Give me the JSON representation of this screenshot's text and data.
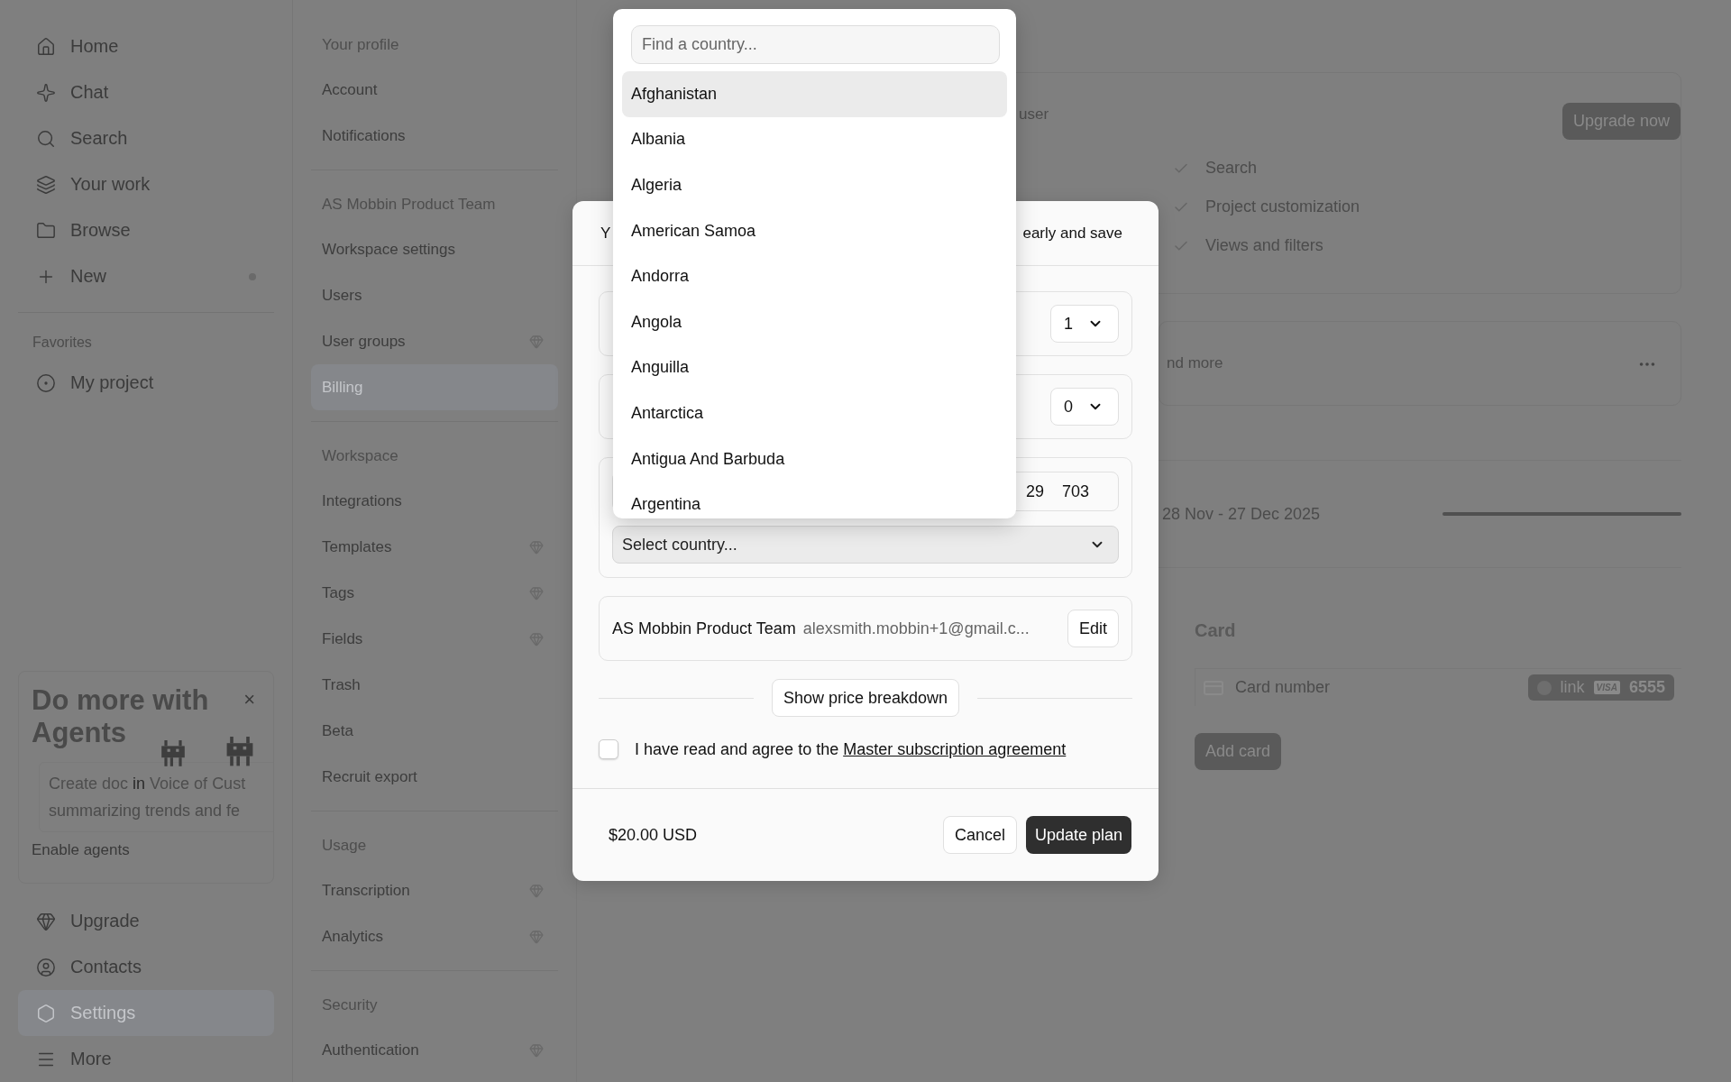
{
  "sidebar": {
    "nav": [
      {
        "label": "Home",
        "selected": false,
        "dot": false
      },
      {
        "label": "Chat",
        "selected": false,
        "dot": false
      },
      {
        "label": "Search",
        "selected": false,
        "dot": false
      },
      {
        "label": "Your work",
        "selected": false,
        "dot": false
      },
      {
        "label": "Browse",
        "selected": false,
        "dot": false
      },
      {
        "label": "New",
        "selected": false,
        "dot": true
      }
    ],
    "favorites_heading": "Favorites",
    "favorites": [
      {
        "label": "My project",
        "selected": false
      }
    ],
    "promo": {
      "title": "Do more with Agents",
      "close": "×",
      "prompt_parts": [
        {
          "text": "Create doc",
          "kind": "token"
        },
        {
          "text": " in ",
          "kind": "plain"
        },
        {
          "text": "Voice of Cust",
          "kind": "token"
        }
      ],
      "prompt_line2": "summarizing trends and fe",
      "action": "Enable agents"
    },
    "bottom": [
      {
        "label": "Upgrade",
        "selected": false
      },
      {
        "label": "Contacts",
        "selected": false
      },
      {
        "label": "Settings",
        "selected": true
      },
      {
        "label": "More",
        "selected": false
      }
    ]
  },
  "settings_nav": {
    "sections": [
      {
        "heading": "Your profile",
        "items": [
          {
            "label": "Account",
            "premium": false,
            "selected": false
          },
          {
            "label": "Notifications",
            "premium": false,
            "selected": false
          }
        ]
      },
      {
        "heading": "AS Mobbin Product Team",
        "items": [
          {
            "label": "Workspace settings",
            "premium": false,
            "selected": false
          },
          {
            "label": "Users",
            "premium": false,
            "selected": false
          },
          {
            "label": "User groups",
            "premium": true,
            "selected": false
          },
          {
            "label": "Billing",
            "premium": false,
            "selected": true
          }
        ]
      },
      {
        "heading": "Workspace",
        "items": [
          {
            "label": "Integrations",
            "premium": false,
            "selected": false
          },
          {
            "label": "Templates",
            "premium": true,
            "selected": false
          },
          {
            "label": "Tags",
            "premium": true,
            "selected": false
          },
          {
            "label": "Fields",
            "premium": true,
            "selected": false
          },
          {
            "label": "Trash",
            "premium": false,
            "selected": false
          },
          {
            "label": "Beta",
            "premium": false,
            "selected": false
          },
          {
            "label": "Recruit export",
            "premium": false,
            "selected": false
          }
        ]
      },
      {
        "heading": "Usage",
        "items": [
          {
            "label": "Transcription",
            "premium": true,
            "selected": false
          },
          {
            "label": "Analytics",
            "premium": true,
            "selected": false
          }
        ]
      },
      {
        "heading": "Security",
        "items": [
          {
            "label": "Authentication",
            "premium": true,
            "selected": false
          }
        ]
      }
    ]
  },
  "main": {
    "plan_card": {
      "fragment": "user",
      "upgrade": "Upgrade now",
      "features": [
        "Search",
        "Project customization",
        "Views and filters"
      ]
    },
    "addon_card": {
      "fragment": "nd more"
    },
    "period": {
      "text": "28 Nov - 27 Dec 2025"
    },
    "card_section": {
      "title": "Card",
      "placeholder": "Card number",
      "link": "link",
      "brand": "VISA",
      "last4": "6555",
      "add": "Add card"
    }
  },
  "modal": {
    "header_left": "Y",
    "header_right": "early and save",
    "seat_selects": [
      {
        "value": "1"
      },
      {
        "value": "0"
      }
    ],
    "card_field": {
      "expiry": "29",
      "cvc": "703"
    },
    "country_select": {
      "label": "Select country..."
    },
    "billing": {
      "name": "AS Mobbin Product Team",
      "email": "alexsmith.mobbin+1@gmail.c...",
      "edit": "Edit"
    },
    "breakdown": "Show price breakdown",
    "agreement": {
      "checked": false,
      "text": "I have read and agree to the ",
      "link": "Master subscription agreement"
    },
    "total": "$20.00 USD",
    "cancel": "Cancel",
    "submit": "Update plan"
  },
  "country_dropdown": {
    "search_placeholder": "Find a country...",
    "options": [
      {
        "label": "Afghanistan",
        "selected": true
      },
      {
        "label": "Albania",
        "selected": false
      },
      {
        "label": "Algeria",
        "selected": false
      },
      {
        "label": "American Samoa",
        "selected": false
      },
      {
        "label": "Andorra",
        "selected": false
      },
      {
        "label": "Angola",
        "selected": false
      },
      {
        "label": "Anguilla",
        "selected": false
      },
      {
        "label": "Antarctica",
        "selected": false
      },
      {
        "label": "Antigua And Barbuda",
        "selected": false
      },
      {
        "label": "Argentina",
        "selected": false
      }
    ]
  }
}
